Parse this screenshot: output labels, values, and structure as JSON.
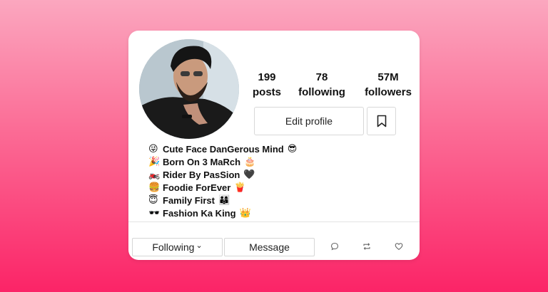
{
  "profile": {
    "stats": [
      {
        "value": "199",
        "label": "posts"
      },
      {
        "value": "78",
        "label": "following"
      },
      {
        "value": "57M",
        "label": "followers"
      }
    ],
    "edit_profile_label": "Edit profile",
    "bio": [
      {
        "emoji": "😜",
        "text": "Cute Face DanGerous Mind",
        "tail": "😎"
      },
      {
        "emoji": "🎉",
        "text": "Born On 3 MaRch",
        "tail": "🎂"
      },
      {
        "emoji": "🏍️",
        "text": "Rider By PasSion",
        "tail": "🖤"
      },
      {
        "emoji": "🍔",
        "text": "Foodie ForEver",
        "tail": "🍟"
      },
      {
        "emoji": "😇",
        "text": "Family First",
        "tail": "👨‍👩‍👦"
      },
      {
        "emoji": "🕶️",
        "text": "Fashion Ka King",
        "tail": "👑"
      }
    ]
  },
  "actions": {
    "following_label": "Following",
    "following_chevron": "⌄",
    "message_label": "Message",
    "icons": [
      "comment-icon",
      "repost-icon",
      "heart-icon"
    ]
  },
  "colors": {
    "background_top": "#fba7bf",
    "background_bottom": "#fb2467",
    "card": "#ffffff"
  }
}
